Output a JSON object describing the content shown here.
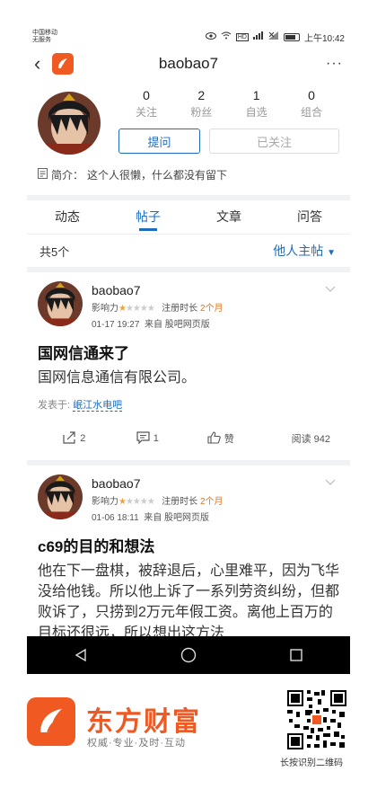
{
  "status_bar": {
    "carrier_line1": "中国移动",
    "carrier_line2": "无服务",
    "hd": "HD",
    "time": "上午10:42"
  },
  "header": {
    "title": "baobao7",
    "more": "···"
  },
  "profile": {
    "stats": [
      {
        "value": "0",
        "label": "关注"
      },
      {
        "value": "2",
        "label": "粉丝"
      },
      {
        "value": "1",
        "label": "自选"
      },
      {
        "value": "0",
        "label": "组合"
      }
    ],
    "ask_button": "提问",
    "followed_button": "已关注",
    "bio_label": "简介：",
    "bio_text": "这个人很懒，什么都没有留下"
  },
  "tabs": [
    "动态",
    "帖子",
    "文章",
    "问答"
  ],
  "active_tab": "帖子",
  "list": {
    "count": "共5个",
    "hub_link": "他人主帖"
  },
  "posts": [
    {
      "username": "baobao7",
      "influence_label": "影响力",
      "stars": 1,
      "reg_label": "注册时长",
      "reg_value": "2个月",
      "time": "01-17 19:27",
      "source": "来自 股吧网页版",
      "title": "国网信通来了",
      "body": "国网信息通信有限公司。",
      "posted_in_label": "发表于:",
      "forum": "岷江水电吧",
      "shares": "2",
      "comments": "1",
      "like_label": "赞",
      "read": "阅读 942"
    },
    {
      "username": "baobao7",
      "influence_label": "影响力",
      "stars": 1,
      "reg_label": "注册时长",
      "reg_value": "2个月",
      "time": "01-06 18:11",
      "source": "来自 股吧网页版",
      "title": "c69的目的和想法",
      "body": "他在下一盘棋，被辞退后，心里难平，因为飞华没给他钱。所以他上诉了一系列劳资纠纷，但都败诉了，只捞到2万元年假工资。离他上百万的目标还很远，所以想出这方法"
    }
  ],
  "footer": {
    "brand_name": "东方财富",
    "slogan": "权威·专业·及时·互动",
    "qr_caption": "长按识别二维码"
  },
  "colors": {
    "accent": "#1f6cbf",
    "brand": "#f05a22",
    "star": "#f1a33a"
  }
}
